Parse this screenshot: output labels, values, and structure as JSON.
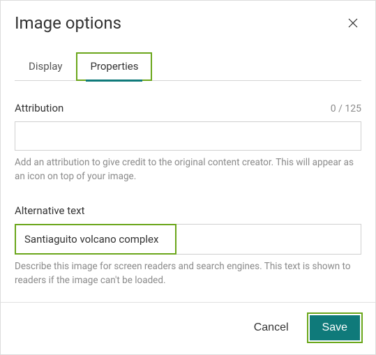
{
  "dialog": {
    "title": "Image options",
    "tabs": {
      "display": "Display",
      "properties": "Properties"
    },
    "attribution": {
      "label": "Attribution",
      "count": "0 / 125",
      "value": "",
      "help": "Add an attribution to give credit to the original content creator. This will appear as an icon on top of your image."
    },
    "alt": {
      "label": "Alternative text",
      "value": "Santiaguito volcano complex",
      "help": "Describe this image for screen readers and search engines. This text is shown to readers if the image can't be loaded."
    },
    "buttons": {
      "cancel": "Cancel",
      "save": "Save"
    }
  }
}
